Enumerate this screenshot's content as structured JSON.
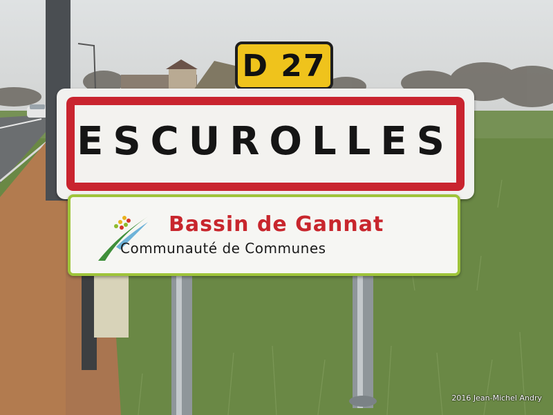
{
  "scene": {
    "description_colors": {
      "sky": "#d9dcdc",
      "grass": "#6d8c47",
      "gravel": "#b07a4f",
      "road": "#6b6e70"
    }
  },
  "route_plate": {
    "label": "D 27",
    "background": "#efc31c"
  },
  "town_sign": {
    "name": "ESCUROLLES",
    "border_color": "#c9242f"
  },
  "sub_sign": {
    "title": "Bassin de Gannat",
    "subtitle": "Communauté de Communes",
    "border_color": "#9fc43a",
    "title_color": "#c8262d"
  },
  "credit": {
    "text": "2016 Jean-Michel Andry"
  }
}
